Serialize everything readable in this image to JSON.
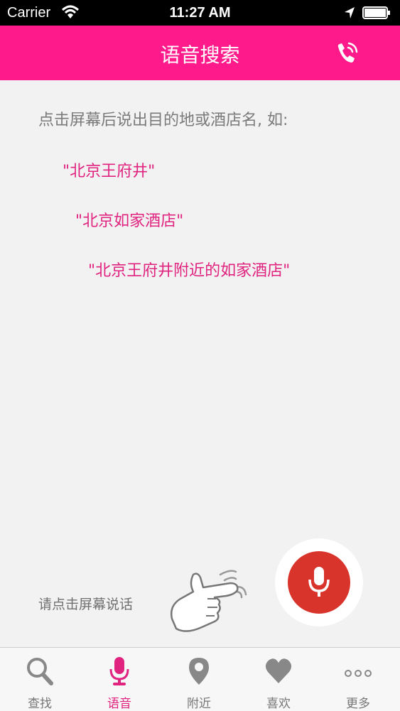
{
  "status_bar": {
    "carrier": "Carrier",
    "time": "11:27 AM"
  },
  "nav": {
    "title": "语音搜索",
    "phone_icon": "phone-call-icon"
  },
  "main": {
    "intro": "点击屏幕后说出目的地或酒店名, 如:",
    "examples": [
      "\"北京王府井\"",
      "\"北京如家酒店\"",
      "\"北京王府井附近的如家酒店\""
    ],
    "hint": "请点击屏幕说话"
  },
  "tabs": [
    {
      "label": "查找",
      "icon": "search-icon"
    },
    {
      "label": "语音",
      "icon": "microphone-icon"
    },
    {
      "label": "附近",
      "icon": "location-pin-icon"
    },
    {
      "label": "喜欢",
      "icon": "heart-icon"
    },
    {
      "label": "更多",
      "icon": "more-dots-icon"
    }
  ],
  "active_tab": "语音",
  "colors": {
    "accent": "#ff1a8c",
    "example_text": "#e0237f",
    "mic_button": "#d9342b",
    "background": "#f2f2f2"
  }
}
